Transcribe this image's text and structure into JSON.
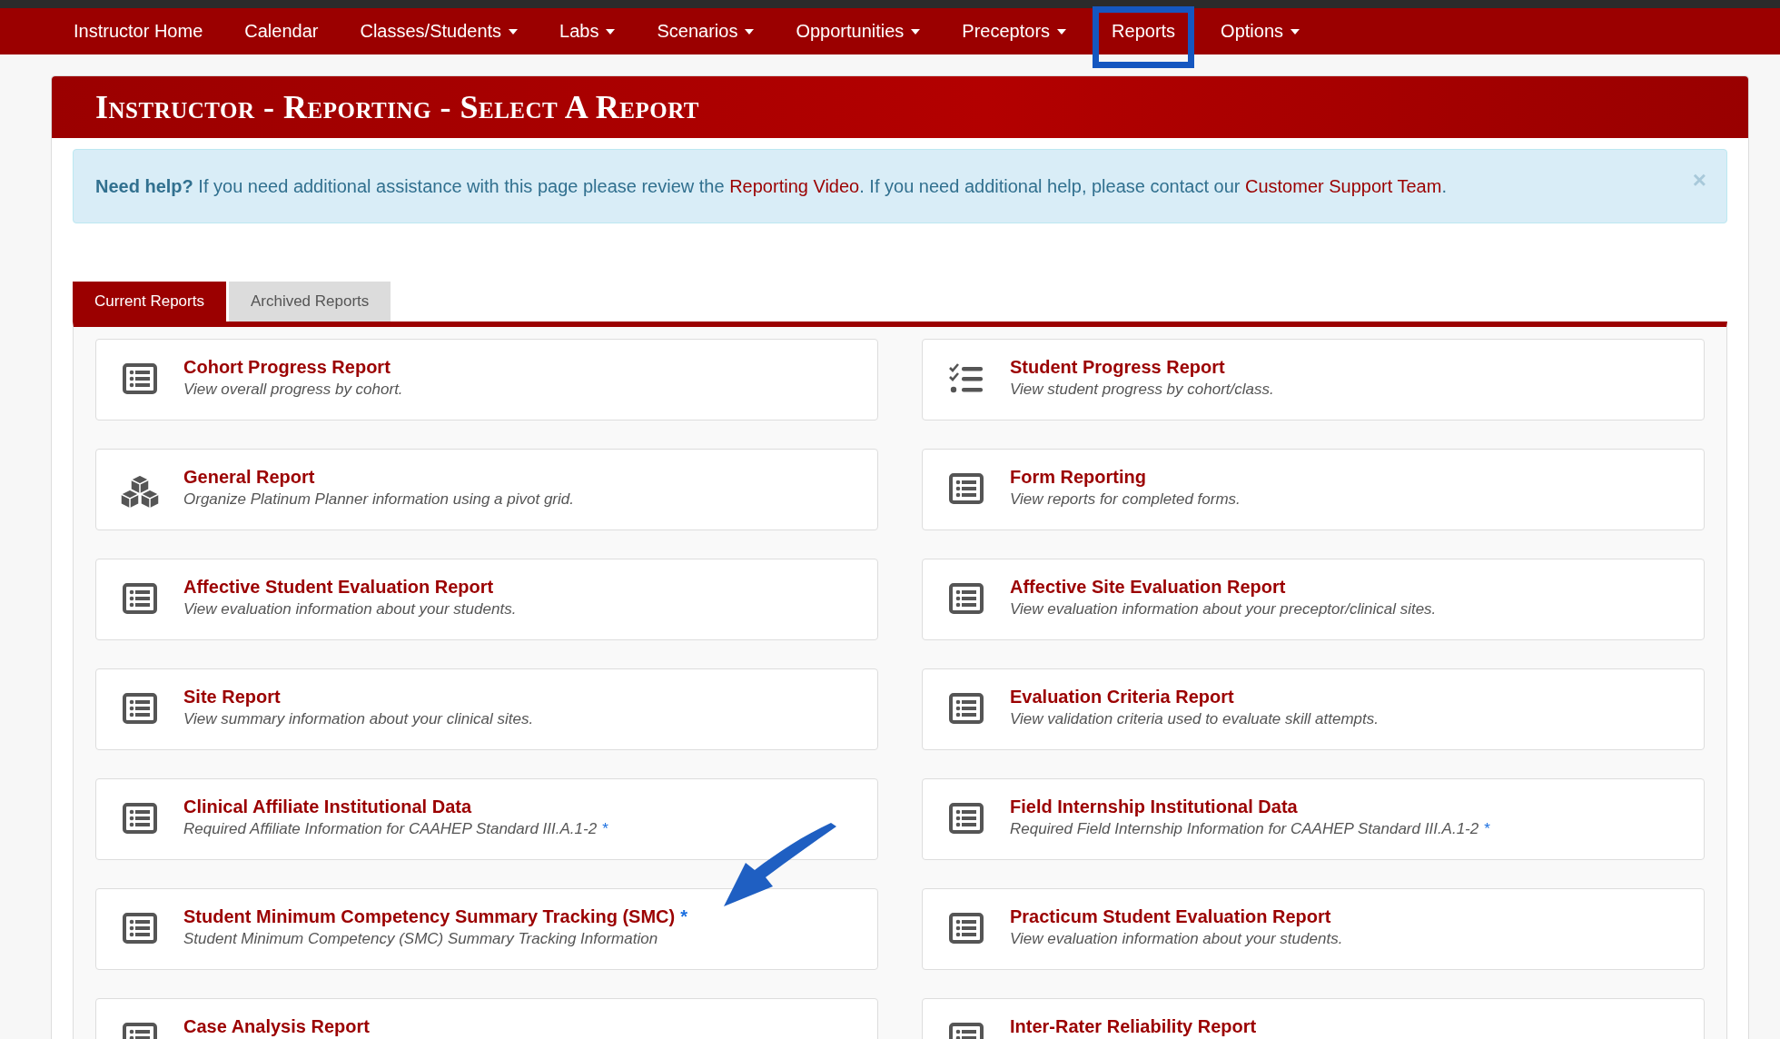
{
  "nav": [
    {
      "label": "Instructor Home",
      "has_menu": false,
      "selected": false
    },
    {
      "label": "Calendar",
      "has_menu": false,
      "selected": false
    },
    {
      "label": "Classes/Students",
      "has_menu": true,
      "selected": false
    },
    {
      "label": "Labs",
      "has_menu": true,
      "selected": false
    },
    {
      "label": "Scenarios",
      "has_menu": true,
      "selected": false
    },
    {
      "label": "Opportunities",
      "has_menu": true,
      "selected": false
    },
    {
      "label": "Preceptors",
      "has_menu": true,
      "selected": false
    },
    {
      "label": "Reports",
      "has_menu": false,
      "selected": true
    },
    {
      "label": "Options",
      "has_menu": true,
      "selected": false
    }
  ],
  "page_title": "Instructor - Reporting - Select A Report",
  "help": {
    "segments": [
      {
        "kind": "text",
        "text": "**Need help?** If you need additional assistance with this page please review the "
      },
      {
        "kind": "link",
        "text": "Reporting Video"
      },
      {
        "kind": "text",
        "text": ". If you need additional help, please contact our "
      },
      {
        "kind": "link",
        "text": "Customer Support Team"
      },
      {
        "kind": "text",
        "text": "."
      }
    ],
    "close": "×"
  },
  "tabs": [
    {
      "label": "Current Reports",
      "selected": true
    },
    {
      "label": "Archived Reports",
      "selected": false
    }
  ],
  "reports": [
    {
      "title": "Cohort Progress Report",
      "description": "View overall progress by cohort.",
      "kind": "list"
    },
    {
      "title": "Student Progress Report",
      "description": "View student progress by cohort/class.",
      "kind": "checklist"
    },
    {
      "title": "General Report",
      "description": "Organize Platinum Planner information using a pivot grid.",
      "kind": "cubes"
    },
    {
      "title": "Form Reporting",
      "description": "View reports for completed forms.",
      "kind": "list"
    },
    {
      "title": "Affective Student Evaluation Report",
      "description": "View evaluation information about your students.",
      "kind": "list"
    },
    {
      "title": "Affective Site Evaluation Report",
      "description": "View evaluation information about your preceptor/clinical sites.",
      "kind": "list"
    },
    {
      "title": "Site Report",
      "description": "View summary information about your clinical sites.",
      "kind": "list"
    },
    {
      "title": "Evaluation Criteria Report",
      "description": "View validation criteria used to evaluate skill attempts.",
      "kind": "list"
    },
    {
      "title": "Clinical Affiliate Institutional Data",
      "description": "Required Affiliate Information for CAAHEP Standard III.A.1-2",
      "description_note": "*",
      "kind": "list"
    },
    {
      "title": "Field Internship Institutional Data",
      "description": "Required Field Internship Information for CAAHEP Standard III.A.1-2",
      "description_note": "*",
      "kind": "list"
    },
    {
      "title": "Student Minimum Competency Summary Tracking (SMC)",
      "title_note": "*",
      "description": "Student Minimum Competency (SMC) Summary Tracking Information",
      "kind": "list",
      "annotated": true
    },
    {
      "title": "Practicum Student Evaluation Report",
      "description": "View evaluation information about your students.",
      "kind": "list"
    },
    {
      "title": "Case Analysis Report",
      "kind": "list"
    },
    {
      "title": "Inter-Rater Reliability Report",
      "kind": "list"
    }
  ]
}
